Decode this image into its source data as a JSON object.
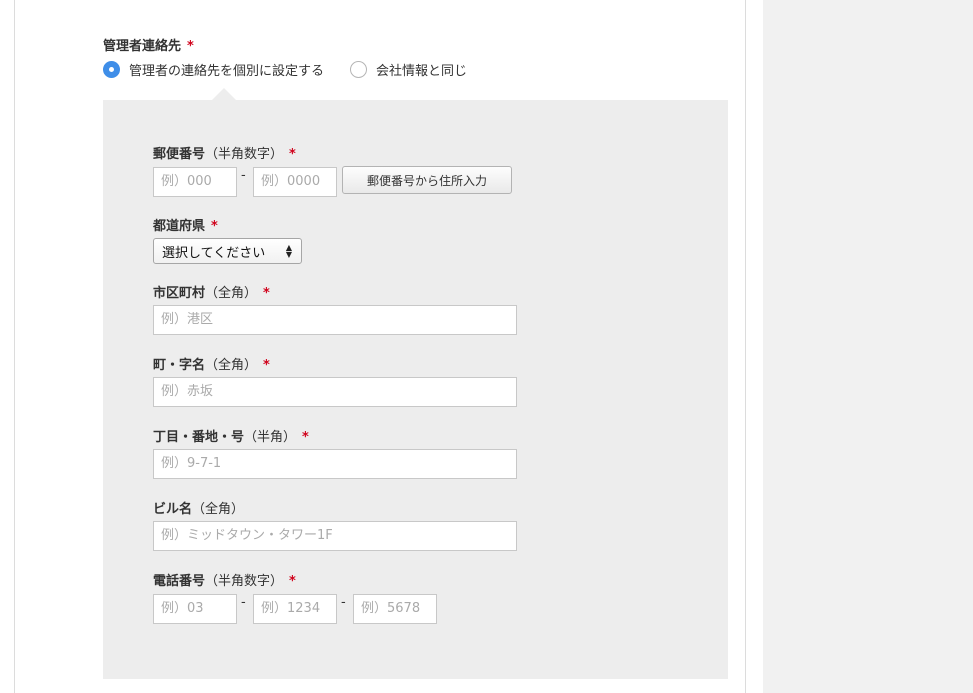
{
  "contact": {
    "label": "管理者連絡先",
    "required_mark": "*",
    "options": [
      {
        "label": "管理者の連絡先を個別に設定する",
        "selected": true
      },
      {
        "label": "会社情報と同じ",
        "selected": false
      }
    ]
  },
  "postal": {
    "label": "郵便番号",
    "note": "（半角数字）",
    "required_mark": "*",
    "placeholder1": "例）000",
    "placeholder2": "例）0000",
    "separator": "-",
    "lookup_button": "郵便番号から住所入力"
  },
  "prefecture": {
    "label": "都道府県",
    "required_mark": "*",
    "selected": "選択してください"
  },
  "city": {
    "label": "市区町村",
    "note": "（全角）",
    "required_mark": "*",
    "placeholder": "例）港区"
  },
  "town": {
    "label": "町・字名",
    "note": "（全角）",
    "required_mark": "*",
    "placeholder": "例）赤坂"
  },
  "block": {
    "label": "丁目・番地・号",
    "note": "（半角）",
    "required_mark": "*",
    "placeholder": "例）9-7-1"
  },
  "building": {
    "label": "ビル名",
    "note": "（全角）",
    "placeholder": "例）ミッドタウン・タワー1F"
  },
  "phone": {
    "label": "電話番号",
    "note": "（半角数字）",
    "required_mark": "*",
    "placeholder1": "例）03",
    "placeholder2": "例）1234",
    "placeholder3": "例）5678",
    "separator": "-"
  },
  "colors": {
    "accent": "#3f8ee8",
    "required": "#d0021b",
    "panel_bg": "#ededed",
    "sidebar_bg": "#f1f1f1"
  }
}
